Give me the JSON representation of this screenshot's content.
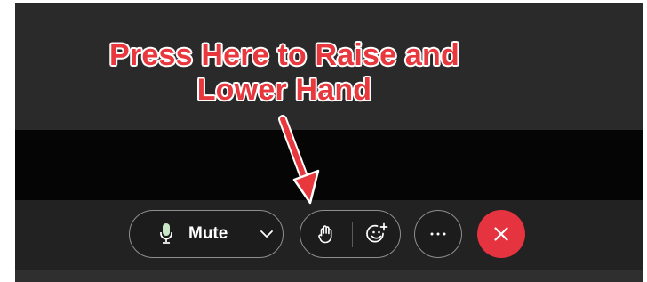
{
  "annotation": {
    "line1": "Press Here to Raise and",
    "line2": "Lower Hand",
    "color": "#e8383d"
  },
  "controls": {
    "mute": {
      "label": "Mute",
      "icon": "microphone-icon",
      "dropdown_icon": "chevron-down-icon"
    },
    "raise_hand": {
      "icon": "raise-hand-icon"
    },
    "reactions": {
      "icon": "add-reaction-icon"
    },
    "more": {
      "icon": "more-options-icon"
    },
    "end_call": {
      "icon": "close-icon",
      "color": "#e5333f"
    }
  },
  "colors": {
    "toolbar_bg": "#222222",
    "pill_border": "#8e8e8e",
    "mic_accent": "#c9e6c9"
  }
}
